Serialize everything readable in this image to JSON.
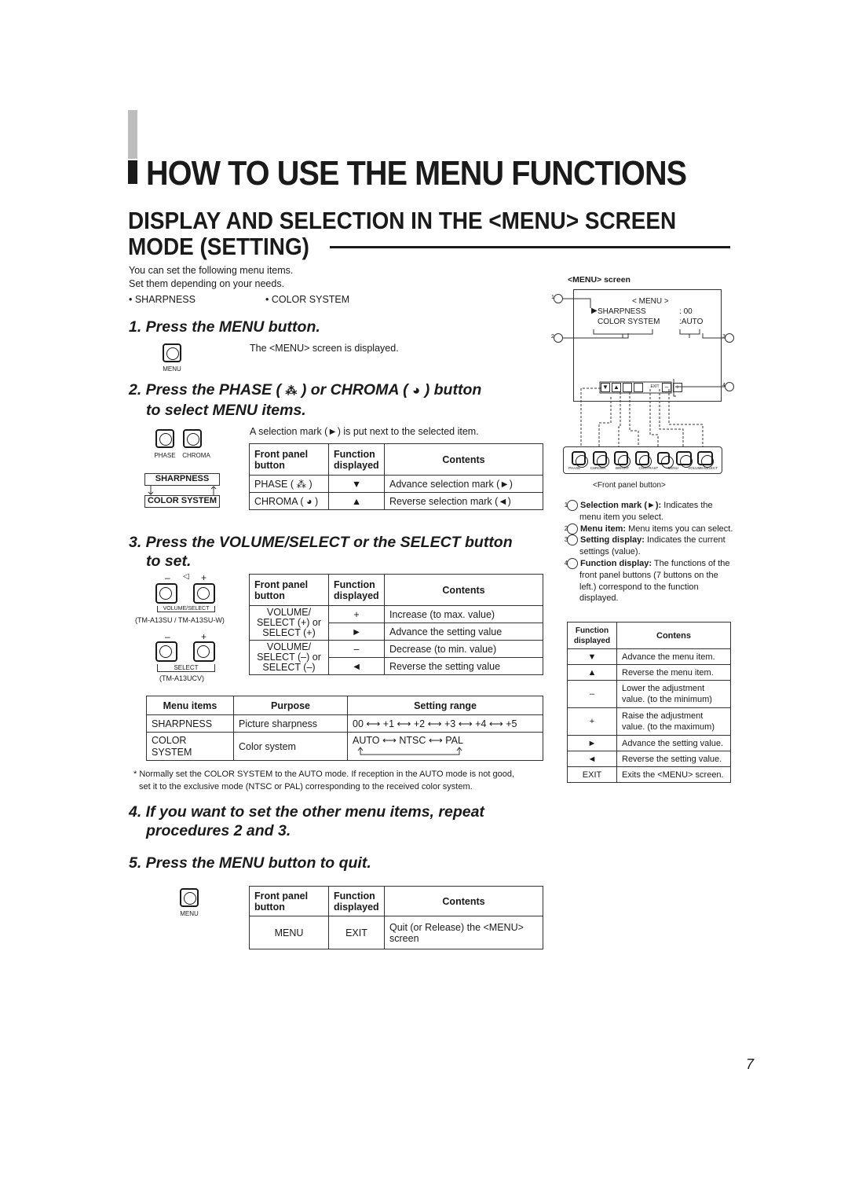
{
  "page": {
    "title": "HOW TO USE THE MENU FUNCTIONS",
    "section_title_line1": "DISPLAY AND SELECTION IN THE <MENU> SCREEN",
    "section_title_line2": "MODE (SETTING)",
    "intro_line1": "You can set the following menu items.",
    "intro_line2": "Set them depending on your needs.",
    "bullets": [
      "• SHARPNESS",
      "• COLOR SYSTEM"
    ],
    "page_number": "7"
  },
  "step1": {
    "title": "1. Press the MENU button.",
    "button_label": "MENU",
    "desc": "The <MENU> screen is displayed."
  },
  "step2": {
    "title_line1": "2. Press the PHASE (",
    "title_mid": " ) or CHROMA (",
    "title_end": " ) button",
    "title_line2": "to select MENU items.",
    "button_labels": [
      "PHASE",
      "CHROMA"
    ],
    "cycle_items": [
      "SHARPNESS",
      "COLOR SYSTEM"
    ],
    "desc": "A selection mark (►) is put next to the selected item.",
    "table": {
      "headers": [
        "Front panel button",
        "Function displayed",
        "Contents"
      ],
      "rows": [
        [
          "PHASE (",
          ")",
          "▼",
          "Advance selection mark (►)"
        ],
        [
          "CHROMA (",
          ")",
          "▲",
          "Reverse selection mark (◄)"
        ]
      ]
    }
  },
  "step3": {
    "title_line1": "3. Press the VOLUME/SELECT or the SELECT  button",
    "title_line2": "to set.",
    "group1_label": "VOLUME/SELECT",
    "group1_models": "(TM-A13SU / TM-A13SU-W)",
    "group2_label": "SELECT",
    "group2_models": "(TM-A13UCV)",
    "minus": "–",
    "plus": "+",
    "table": {
      "headers": [
        "Front panel button",
        "Function displayed",
        "Contents"
      ],
      "groups": [
        {
          "button": "VOLUME/ SELECT (+) or SELECT (+)",
          "rows": [
            [
              "+",
              "Increase (to max. value)"
            ],
            [
              "►",
              "Advance the setting value"
            ]
          ]
        },
        {
          "button": "VOLUME/ SELECT (–) or SELECT (–)",
          "rows": [
            [
              "–",
              "Decrease (to min. value)"
            ],
            [
              "◄",
              "Reverse the setting value"
            ]
          ]
        }
      ]
    }
  },
  "items_table": {
    "headers": [
      "Menu items",
      "Purpose",
      "Setting range"
    ],
    "rows": [
      {
        "item": "SHARPNESS",
        "purpose": "Picture sharpness",
        "range": "00 ⟷ +1 ⟷ +2 ⟷ +3 ⟷ +4 ⟷ +5"
      },
      {
        "item": "COLOR SYSTEM",
        "purpose": "Color system",
        "range": "AUTO ⟷ NTSC ⟷ PAL"
      }
    ],
    "note_line1": "* Normally set the COLOR SYSTEM to the AUTO mode. If reception in the AUTO mode is not good,",
    "note_line2": "set it to the exclusive mode (NTSC or PAL) corresponding to the received color system."
  },
  "step4": {
    "title_line1": "4. If you want to set the other menu items, repeat",
    "title_line2": "procedures 2 and 3."
  },
  "step5": {
    "title": "5. Press the MENU button to quit.",
    "button_label": "MENU",
    "table": {
      "headers": [
        "Front panel button",
        "Function displayed",
        "Contents"
      ],
      "row": [
        "MENU",
        "EXIT",
        "Quit (or Release) the <MENU> screen"
      ]
    }
  },
  "menu_screen": {
    "caption": "<MENU> screen",
    "title": "< MENU >",
    "items": [
      {
        "name": "SHARPNESS",
        "value": "00"
      },
      {
        "name": "COLOR SYSTEM",
        "value": "AUTO"
      }
    ],
    "function_icons": [
      "▼",
      "▲",
      "",
      "",
      "EXIT",
      "–",
      "+"
    ],
    "callouts": [
      "1",
      "2",
      "3",
      "4"
    ],
    "front_panel_buttons": [
      "PHASE",
      "CHROMA",
      "BRIGHT",
      "CONTRAST",
      "MENU",
      "VOLUME/SELECT"
    ],
    "front_panel_caption": "<Front panel button>"
  },
  "legend": [
    {
      "num": "1",
      "term": "Selection mark (►):",
      "desc": " Indicates the menu item you select."
    },
    {
      "num": "2",
      "term": "Menu item:",
      "desc": " Menu items you can select."
    },
    {
      "num": "3",
      "term": "Setting display:",
      "desc": " Indicates the current settings (value)."
    },
    {
      "num": "4",
      "term": "Function display:",
      "desc": " The functions of the front panel buttons (7 buttons on the left.) correspond to the function displayed."
    }
  ],
  "function_table": {
    "headers": [
      "Function displayed",
      "Contens"
    ],
    "rows": [
      [
        "▼",
        "Advance the menu item."
      ],
      [
        "▲",
        "Reverse the menu item."
      ],
      [
        "–",
        "Lower the adjustment value. (to the minimum)"
      ],
      [
        "+",
        "Raise the adjustment value. (to the maximum)"
      ],
      [
        "►",
        "Advance the setting value."
      ],
      [
        "◄",
        "Reverse the setting value."
      ],
      [
        "EXIT",
        "Exits the <MENU> screen."
      ]
    ]
  }
}
